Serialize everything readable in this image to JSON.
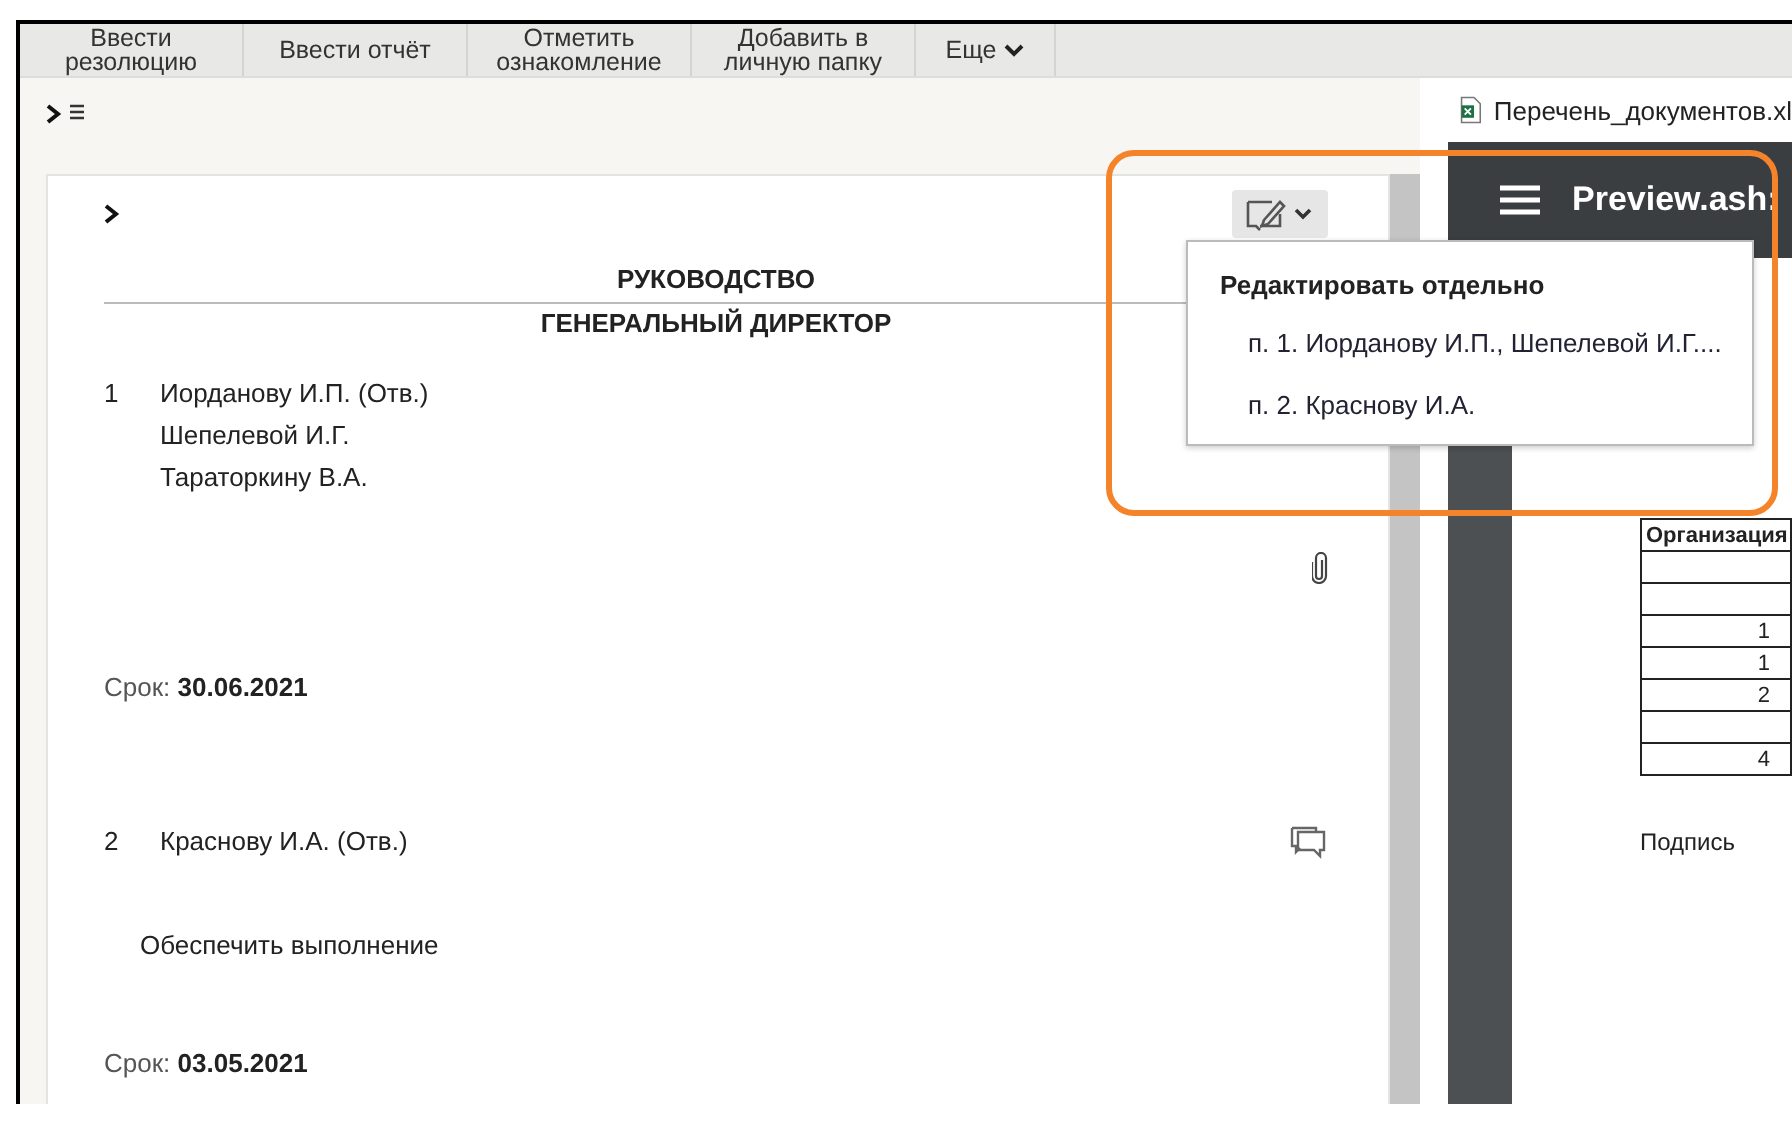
{
  "toolbar": {
    "buttons": [
      {
        "label": "Ввести резолюцию"
      },
      {
        "label": "Ввести отчёт"
      },
      {
        "label": "Отметить ознакомление"
      },
      {
        "label": "Добавить в личную папку"
      },
      {
        "label": "Еще"
      }
    ]
  },
  "document": {
    "header": "РУКОВОДСТВО",
    "subheader": "ГЕНЕРАЛЬНЫЙ ДИРЕКТОР",
    "items": [
      {
        "number": "1",
        "assignees": [
          "Иорданову И.П.  (Отв.)",
          "Шепелевой И.Г.",
          "Тараторкину В.А."
        ],
        "deadline_label": "Срок:",
        "deadline": "30.06.2021"
      },
      {
        "number": "2",
        "assignees": [
          "Краснову И.А.  (Отв.)"
        ],
        "text": "Обеспечить выполнение",
        "deadline_label": "Срок:",
        "deadline": "03.05.2021"
      }
    ]
  },
  "edit_menu": {
    "title": "Редактировать отдельно",
    "items": [
      "п. 1. Иорданову И.П., Шепелевой И.Г....",
      "п. 2. Краснову И.А."
    ]
  },
  "preview": {
    "file_name": "Перечень_документов.xl",
    "title": "Preview.ash:",
    "table": {
      "header": "Организация",
      "cells": [
        "",
        "",
        "1",
        "1",
        "2",
        "",
        "4"
      ]
    },
    "signature": "Подпись"
  }
}
